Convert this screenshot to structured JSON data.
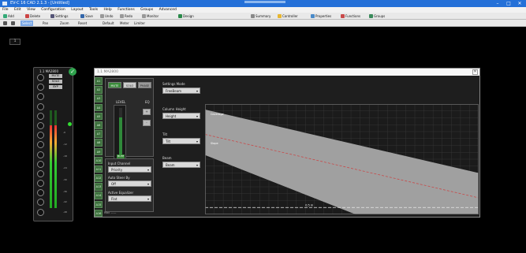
{
  "titlebar": {
    "title": "EV-C 16 CAD 2.1.3 - [Untitled]",
    "minimize": "–",
    "maximize": "□",
    "close": "✕"
  },
  "menu": [
    "File",
    "Edit",
    "View",
    "Configuration",
    "Layout",
    "Tools",
    "Help",
    "Functions",
    "Groups",
    "Advanced"
  ],
  "toolbar1": [
    "Add",
    "Delete",
    "Settings",
    "Save",
    "Undo",
    "Redo",
    "Monitor",
    "Design",
    "Summary",
    "Controller",
    "Properties",
    "Functions",
    "Groups"
  ],
  "toolbar2": [
    "Select",
    "Pan",
    "Zoom",
    "Reset",
    "Default",
    "Meter",
    "Limiter"
  ],
  "tab_number": "1",
  "speaker": {
    "name": "1.1 MA2800",
    "buttons": [
      "MUTE",
      "SOLO",
      "BYP"
    ],
    "ticks": [
      "-6",
      "-12",
      "-18",
      "-24",
      "-30",
      "-36",
      "-42",
      "-48"
    ],
    "level": 0.85
  },
  "dialog": {
    "title": "1.1 MA2800",
    "close": "✕",
    "left_tabs": [
      "A1",
      "A2",
      "A3",
      "A4",
      "A5",
      "A6",
      "A7",
      "A8",
      "A9",
      "A10",
      "A11",
      "A12",
      "A13",
      "A14",
      "A15",
      "A16"
    ],
    "modes": [
      "MUTE",
      "SOLO",
      "PHASE"
    ],
    "level_label": "LEVEL",
    "gain_label": "EQ",
    "mute_label": "MUTE",
    "level_value": 0.8,
    "side_buttons": [
      "+",
      "-"
    ],
    "input_channel_label": "Input Channel",
    "input_channel_value": "Priority",
    "auto_steer_label": "Auto Steer By",
    "auto_steer_value": "Off",
    "active_equalizer_label": "Active Equalizer",
    "active_equalizer_value": "Flat",
    "settings_mode_label": "Settings Mode",
    "settings_mode_value": "FreeBeam",
    "column_height_label": "Column Height",
    "column_height_value": "Height",
    "tilt_label": "Tilt",
    "tilt_value": "Tilt",
    "beam_label": "Beam",
    "beam_value": "Beam",
    "status_text": "Max ——"
  },
  "chart_data": {
    "type": "area",
    "title": "",
    "xlabel": "",
    "ylabel": "",
    "xlim": [
      0,
      30
    ],
    "ylim": [
      0,
      8
    ],
    "grid": true,
    "upper_boundary": [
      [
        0,
        7.6
      ],
      [
        30,
        3.0
      ]
    ],
    "lower_boundary": [
      [
        0,
        4.3
      ],
      [
        16.5,
        0
      ]
    ],
    "center_line": [
      [
        0,
        5.8
      ],
      [
        30,
        1.2
      ]
    ],
    "listener_height": 0.5,
    "labels": [
      {
        "text": "Coverage",
        "x": 0.6,
        "y": 7.2
      },
      {
        "text": "Slope",
        "x": 0.6,
        "y": 5.1
      },
      {
        "text": "0.5 m",
        "x": 11,
        "y": 0.6
      }
    ],
    "colors": {
      "coverage": "#a0a0a0",
      "background": "#1b1b1b",
      "grid": "#3a3a3a",
      "center_line": "#c84a4a",
      "listener_line": "#e8e8e8"
    }
  }
}
